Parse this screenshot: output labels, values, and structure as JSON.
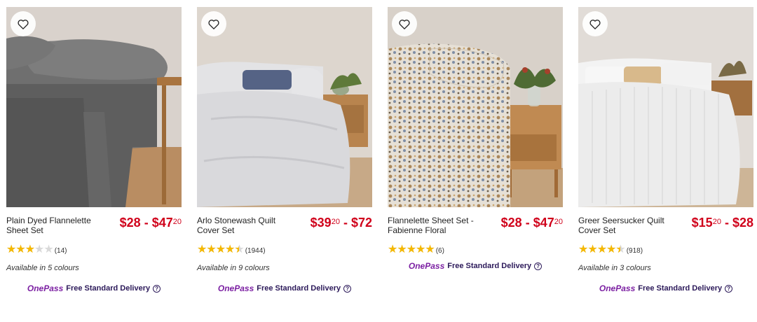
{
  "products": [
    {
      "name": "Plain Dyed Flannelette Sheet Set",
      "price_a": "$28",
      "price_sep": " - ",
      "price_b": "$47",
      "price_b_cents": "20",
      "price_a_cents": "",
      "rating": 3,
      "rating_count": "(14)",
      "colours": "Available in 5 colours",
      "onepass": "OnePass",
      "delivery": "Free Standard Delivery"
    },
    {
      "name": "Arlo Stonewash Quilt Cover Set",
      "price_a": "$39",
      "price_a_cents": "20",
      "price_sep": " - ",
      "price_b": "$72",
      "price_b_cents": "",
      "rating": 4.5,
      "rating_count": "(1944)",
      "colours": "Available in 9 colours",
      "onepass": "OnePass",
      "delivery": "Free Standard Delivery"
    },
    {
      "name": "Flannelette Sheet Set - Fabienne Floral",
      "price_a": "$28",
      "price_a_cents": "",
      "price_sep": " - ",
      "price_b": "$47",
      "price_b_cents": "20",
      "rating": 5,
      "rating_count": "(6)",
      "colours": "",
      "onepass": "OnePass",
      "delivery": "Free Standard Delivery"
    },
    {
      "name": "Greer Seersucker Quilt Cover Set",
      "price_a": "$15",
      "price_a_cents": "20",
      "price_sep": " - ",
      "price_b": "$28",
      "price_b_cents": "",
      "rating": 4.5,
      "rating_count": "(918)",
      "colours": "Available in 3 colours",
      "onepass": "OnePass",
      "delivery": "Free Standard Delivery"
    }
  ],
  "icons": {
    "wishlist": "heart-icon",
    "help": "question-circle-icon"
  },
  "colors": {
    "price": "#d0021b",
    "star": "#f5b800",
    "onepass": "#7b1fa2"
  }
}
